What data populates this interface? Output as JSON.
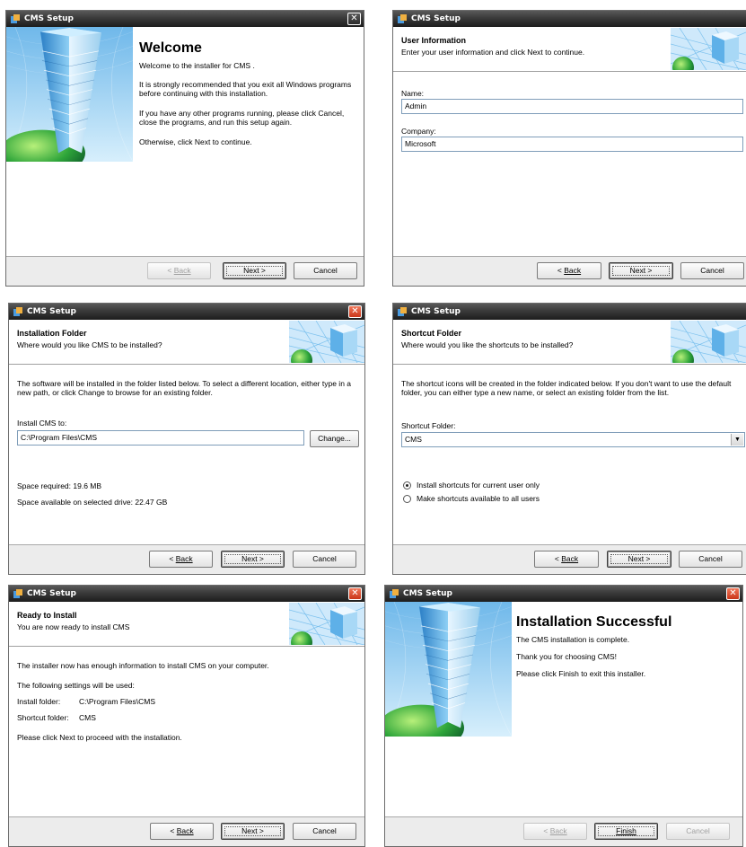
{
  "app_title": "CMS Setup",
  "buttons": {
    "back": "Back",
    "next": "Next >",
    "cancel": "Cancel",
    "finish": "Finish",
    "change": "Change...",
    "back_prefix": "< "
  },
  "welcome": {
    "heading": "Welcome",
    "p1": "Welcome to the installer for CMS .",
    "p2a": "It is strongly recommended that you exit all Windows programs",
    "p2b": "before continuing with this installation.",
    "p3a": "If you have any other programs running, please click Cancel,",
    "p3b": "close the programs, and run this setup again.",
    "p4": "Otherwise, click Next to continue."
  },
  "user_info": {
    "title": "User Information",
    "subtitle": "Enter your user information and click Next to continue.",
    "name_label": "Name:",
    "name_value": "Admin",
    "company_label": "Company:",
    "company_value": "Microsoft"
  },
  "install_folder": {
    "title": "Installation Folder",
    "subtitle": "Where would you like CMS to be installed?",
    "desc1": "The software will be installed in the folder listed below. To select a different location, either type in a",
    "desc2": "new path, or click Change to browse for an existing folder.",
    "path_label": "Install CMS to:",
    "path_value": "C:\\Program Files\\CMS",
    "space_required": "Space required: 19.6 MB",
    "space_available": "Space available on selected drive: 22.47 GB"
  },
  "shortcut_folder": {
    "title": "Shortcut Folder",
    "subtitle": "Where would you like the shortcuts to be installed?",
    "desc1": "The shortcut icons will be created in the folder indicated below. If you don't want to use the default",
    "desc2": "folder, you can either type a new name, or select an existing folder from the list.",
    "folder_label": "Shortcut Folder:",
    "folder_value": "CMS",
    "radio_current": "Install shortcuts for current user only",
    "radio_all": "Make shortcuts available to all users"
  },
  "ready": {
    "title": "Ready to Install",
    "subtitle": "You are now ready to install CMS",
    "l1": "The installer now has enough information to install CMS on your computer.",
    "l2": "The following settings will be used:",
    "install_folder_label": "Install folder:",
    "install_folder_value": "C:\\Program Files\\CMS",
    "shortcut_folder_label": "Shortcut folder:",
    "shortcut_folder_value": "CMS",
    "l3": "Please click Next to proceed with the installation."
  },
  "success": {
    "heading": "Installation Successful",
    "l1": "The CMS  installation is complete.",
    "l2": "Thank you for choosing CMS!",
    "l3": "Please click Finish to exit this installer."
  }
}
